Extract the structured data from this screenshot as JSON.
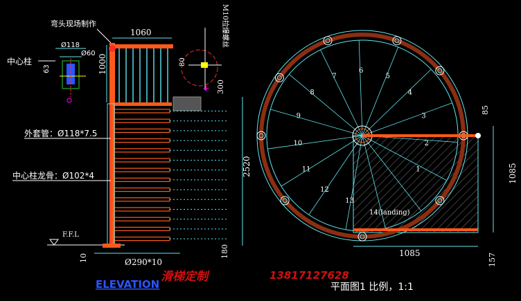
{
  "colors": {
    "background": "#000000",
    "cyan": "#5fe8f0",
    "green": "#33cc33",
    "red": "#ff2a2a",
    "orange": "#ff5a1a",
    "white": "#ffffff",
    "yellow": "#ffff00",
    "blue_label": "#2a55ff",
    "watermark": "#d01010"
  },
  "labels": {
    "bend_note": "弯头现场制作",
    "center_post": "中心柱",
    "d118": "Ø118",
    "d60": "Ø60",
    "dim63": "63",
    "dim1060": "1060",
    "dim1000": "1000",
    "dim80": "80",
    "dim300": "300",
    "m10": "M10拉爆螺丝",
    "sleeve": "外套管：Ø118*7.5",
    "keel": "中心柱龙骨：Ø102*4",
    "dim2520": "2520",
    "ffl": "F.F.L",
    "dim10": "10",
    "d290": "Ø290*10",
    "dim180": "180",
    "elevation": "ELEVATION",
    "plan_title": "平面图1  比例，1:1",
    "dim85": "85",
    "dim1085v": "1085",
    "dim1085h": "1085",
    "dim157": "157",
    "landing": "14(landing)",
    "watermark_text": "滑梯定制",
    "watermark_phone": "13817127628"
  },
  "steps": [
    "1",
    "2",
    "3",
    "4",
    "5",
    "6",
    "7",
    "8",
    "9",
    "10",
    "11",
    "12",
    "13"
  ]
}
